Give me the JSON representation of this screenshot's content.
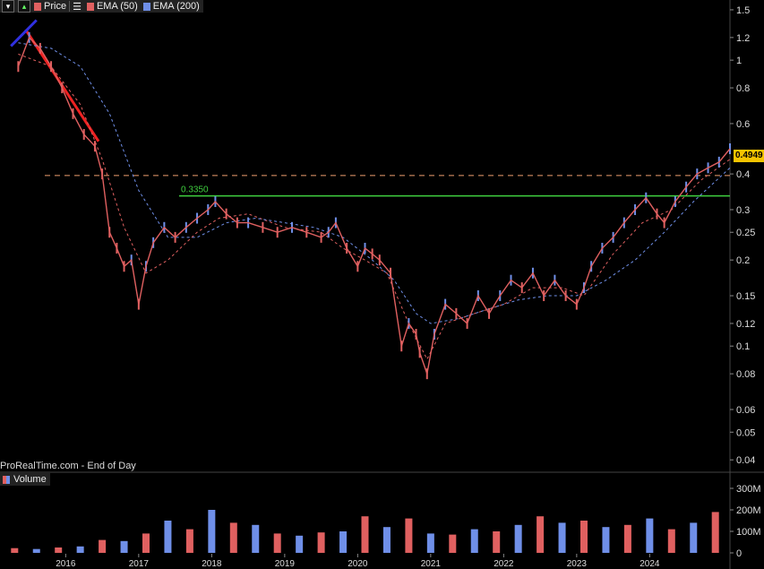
{
  "toolbar": {
    "price_label": "Price",
    "ema50_label": "EMA (50)",
    "ema200_label": "EMA (200)",
    "ema50_color": "#e06060",
    "ema200_color": "#6f8fe8"
  },
  "volume_panel": {
    "label": "Volume"
  },
  "footer": {
    "source": "ProRealTime.com - End of Day"
  },
  "last_price": "0.4949",
  "annotations": {
    "support_label": "0.3350"
  },
  "chart_data": [
    {
      "type": "line",
      "scale": "log",
      "ylim": [
        0.037,
        1.6
      ],
      "yticks": [
        1.5,
        1.2,
        1,
        0.8,
        0.6,
        0.4,
        0.3,
        0.25,
        0.2,
        0.15,
        0.12,
        0.1,
        0.08,
        0.06,
        0.05,
        0.04
      ],
      "xticks": [
        "2016",
        "2017",
        "2018",
        "2019",
        "2020",
        "2021",
        "2022",
        "2023",
        "2024"
      ],
      "series": [
        {
          "name": "Price",
          "color": "#e06060",
          "x": [
            2015.35,
            2015.5,
            2015.65,
            2015.8,
            2015.95,
            2016.1,
            2016.25,
            2016.4,
            2016.5,
            2016.6,
            2016.7,
            2016.8,
            2016.9,
            2017.0,
            2017.1,
            2017.2,
            2017.35,
            2017.5,
            2017.65,
            2017.8,
            2017.95,
            2018.05,
            2018.2,
            2018.35,
            2018.5,
            2018.7,
            2018.9,
            2019.1,
            2019.3,
            2019.5,
            2019.6,
            2019.7,
            2019.85,
            2020.0,
            2020.1,
            2020.2,
            2020.3,
            2020.45,
            2020.6,
            2020.7,
            2020.8,
            2020.85,
            2020.95,
            2021.05,
            2021.2,
            2021.35,
            2021.5,
            2021.65,
            2021.8,
            2021.95,
            2022.1,
            2022.25,
            2022.4,
            2022.55,
            2022.7,
            2022.85,
            2023.0,
            2023.1,
            2023.2,
            2023.35,
            2023.5,
            2023.65,
            2023.8,
            2023.95,
            2024.1,
            2024.2,
            2024.35,
            2024.5,
            2024.65,
            2024.8,
            2024.95,
            2025.1
          ],
          "y": [
            0.95,
            1.2,
            1.1,
            0.95,
            0.8,
            0.65,
            0.55,
            0.5,
            0.4,
            0.25,
            0.22,
            0.19,
            0.2,
            0.14,
            0.19,
            0.23,
            0.26,
            0.24,
            0.26,
            0.28,
            0.3,
            0.32,
            0.29,
            0.27,
            0.27,
            0.26,
            0.25,
            0.26,
            0.25,
            0.24,
            0.25,
            0.27,
            0.22,
            0.19,
            0.22,
            0.21,
            0.2,
            0.18,
            0.1,
            0.12,
            0.11,
            0.095,
            0.08,
            0.11,
            0.14,
            0.13,
            0.12,
            0.15,
            0.13,
            0.15,
            0.17,
            0.16,
            0.18,
            0.15,
            0.17,
            0.15,
            0.14,
            0.16,
            0.19,
            0.22,
            0.24,
            0.27,
            0.3,
            0.33,
            0.29,
            0.27,
            0.32,
            0.36,
            0.4,
            0.42,
            0.44,
            0.49
          ]
        },
        {
          "name": "EMA (50)",
          "color": "#e06060",
          "x": [
            2015.35,
            2015.8,
            2016.2,
            2016.5,
            2016.8,
            2017.1,
            2017.4,
            2017.8,
            2018.1,
            2018.5,
            2019.0,
            2019.5,
            2019.8,
            2020.1,
            2020.4,
            2020.7,
            2020.95,
            2021.2,
            2021.6,
            2022.0,
            2022.4,
            2022.8,
            2023.1,
            2023.5,
            2023.9,
            2024.3,
            2024.7,
            2025.1
          ],
          "y": [
            1.05,
            0.95,
            0.7,
            0.45,
            0.26,
            0.18,
            0.2,
            0.25,
            0.28,
            0.29,
            0.26,
            0.25,
            0.22,
            0.2,
            0.18,
            0.12,
            0.09,
            0.12,
            0.13,
            0.14,
            0.16,
            0.16,
            0.15,
            0.21,
            0.27,
            0.3,
            0.38,
            0.45
          ]
        },
        {
          "name": "EMA (200)",
          "color": "#6f8fe8",
          "x": [
            2015.35,
            2015.8,
            2016.2,
            2016.6,
            2017.0,
            2017.4,
            2017.8,
            2018.2,
            2018.6,
            2019.0,
            2019.4,
            2019.8,
            2020.2,
            2020.5,
            2020.8,
            2021.0,
            2021.4,
            2021.8,
            2022.2,
            2022.6,
            2023.0,
            2023.4,
            2023.8,
            2024.2,
            2024.6,
            2025.1
          ],
          "y": [
            1.15,
            1.1,
            0.95,
            0.65,
            0.35,
            0.24,
            0.24,
            0.27,
            0.28,
            0.27,
            0.26,
            0.24,
            0.2,
            0.17,
            0.13,
            0.12,
            0.125,
            0.135,
            0.145,
            0.15,
            0.15,
            0.17,
            0.2,
            0.25,
            0.32,
            0.42
          ]
        }
      ],
      "annotations": [
        {
          "type": "hline",
          "y": 0.335,
          "style": "solid",
          "color": "#3fcf3f",
          "label": "0.3350"
        },
        {
          "type": "hline",
          "y": 0.395,
          "style": "dashed",
          "color": "#f0a070"
        },
        {
          "type": "trendline",
          "color": "#ee2222",
          "x": [
            2015.45,
            2016.45
          ],
          "y": [
            1.28,
            0.52
          ]
        },
        {
          "type": "trendline",
          "color": "#3030e0",
          "x": [
            2015.25,
            2015.6
          ],
          "y": [
            1.12,
            1.38
          ]
        }
      ]
    },
    {
      "type": "bar",
      "title": "Volume",
      "ylim": [
        0,
        300
      ],
      "yticks": [
        "300M",
        "200M",
        "100M",
        "0"
      ],
      "x_range": [
        2015.1,
        2025.1
      ],
      "x": [
        2015.3,
        2015.6,
        2015.9,
        2016.2,
        2016.5,
        2016.8,
        2017.1,
        2017.4,
        2017.7,
        2018.0,
        2018.3,
        2018.6,
        2018.9,
        2019.2,
        2019.5,
        2019.8,
        2020.1,
        2020.4,
        2020.7,
        2021.0,
        2021.3,
        2021.6,
        2021.9,
        2022.2,
        2022.5,
        2022.8,
        2023.1,
        2023.4,
        2023.7,
        2024.0,
        2024.3,
        2024.6,
        2024.9
      ],
      "values": [
        22,
        18,
        25,
        30,
        60,
        55,
        90,
        150,
        110,
        200,
        140,
        130,
        90,
        80,
        95,
        100,
        170,
        120,
        160,
        90,
        85,
        110,
        100,
        130,
        170,
        140,
        150,
        120,
        130,
        160,
        110,
        140,
        190
      ]
    }
  ]
}
